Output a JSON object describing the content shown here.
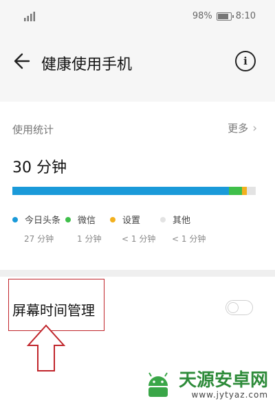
{
  "status_bar": {
    "battery": "98%",
    "time": "8:10"
  },
  "header": {
    "title": "健康使用手机",
    "back_icon": "arrow-left-icon",
    "info_icon": "info-icon"
  },
  "usage": {
    "label": "使用统计",
    "more": "更多",
    "total": "30 分钟",
    "segments": [
      {
        "name": "今日头条",
        "time": "27 分钟",
        "color": "#1a9ad9",
        "fraction": 0.89
      },
      {
        "name": "微信",
        "time": "1 分钟",
        "color": "#3fbf4a",
        "fraction": 0.055
      },
      {
        "name": "设置",
        "time": "< 1 分钟",
        "color": "#f2b01e",
        "fraction": 0.02
      },
      {
        "name": "其他",
        "time": "< 1 分钟",
        "color": "#e3e3e3",
        "fraction": 0.035
      }
    ]
  },
  "screen_time": {
    "label": "屏幕时间管理",
    "enabled": false
  },
  "colors": {
    "annotation": "#c0242a",
    "watermark": "#2e8b3a"
  },
  "watermark": {
    "main": "天源安卓网",
    "sub": "www.jytyaz.com"
  }
}
